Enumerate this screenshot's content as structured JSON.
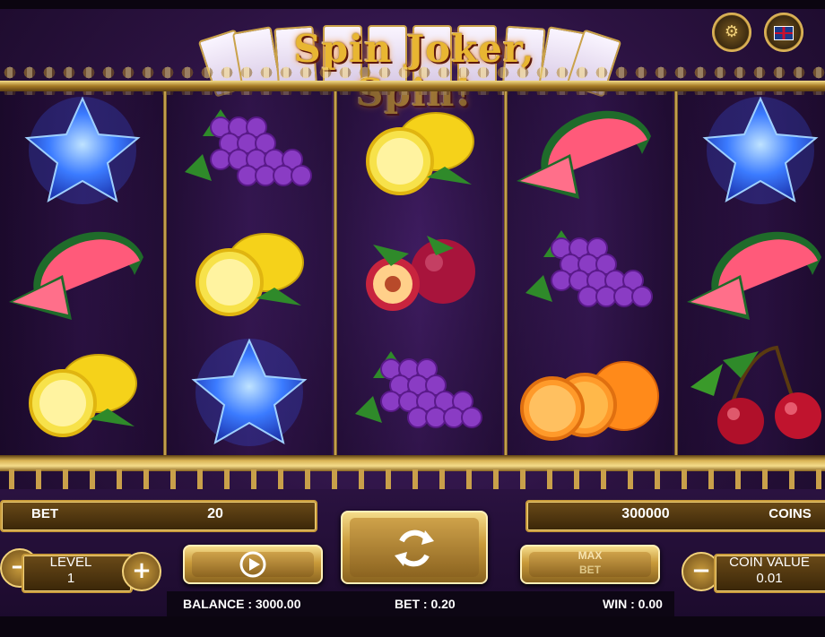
{
  "title": "Spin Joker, Spin!",
  "top_buttons": [
    {
      "name": "settings-icon",
      "glyph": "⚙"
    },
    {
      "name": "language-flag-icon",
      "glyph": ""
    }
  ],
  "reels": [
    [
      "blue-star",
      "watermelon",
      "lemon"
    ],
    [
      "grapes",
      "lemon",
      "blue-star"
    ],
    [
      "lemon",
      "plum",
      "grapes"
    ],
    [
      "watermelon",
      "grapes",
      "orange"
    ],
    [
      "blue-star",
      "watermelon",
      "cherries"
    ]
  ],
  "controls": {
    "bet_label": "BET",
    "bet_value": "20",
    "coins_value": "300000",
    "coins_label": "COINS",
    "level_label": "LEVEL",
    "level_value": "1",
    "plus": "+",
    "minus": "−",
    "max_label": "MAX",
    "max_sub": "BET",
    "coin_value_label": "COIN VALUE",
    "coin_value": "0.01"
  },
  "status": {
    "balance": "BALANCE : 3000.00",
    "bet": "BET : 0.20",
    "win": "WIN : 0.00"
  },
  "colors": {
    "gold": "#c89b3c",
    "purple_bg": "#2b1240",
    "star_blue": "#2f6bff"
  }
}
